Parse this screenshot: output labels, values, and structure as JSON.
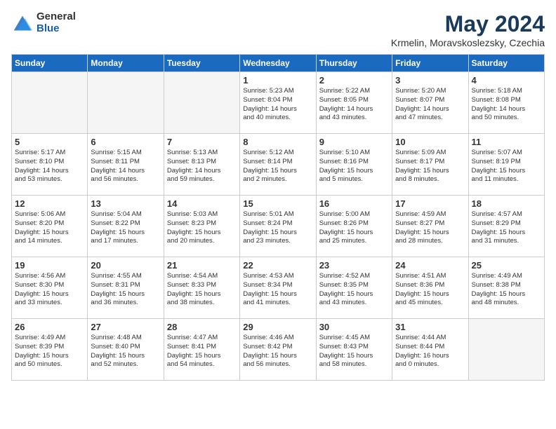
{
  "logo": {
    "general": "General",
    "blue": "Blue"
  },
  "title": {
    "month": "May 2024",
    "location": "Krmelin, Moravskoslezsky, Czechia"
  },
  "headers": [
    "Sunday",
    "Monday",
    "Tuesday",
    "Wednesday",
    "Thursday",
    "Friday",
    "Saturday"
  ],
  "weeks": [
    [
      {
        "day": "",
        "info": ""
      },
      {
        "day": "",
        "info": ""
      },
      {
        "day": "",
        "info": ""
      },
      {
        "day": "1",
        "info": "Sunrise: 5:23 AM\nSunset: 8:04 PM\nDaylight: 14 hours\nand 40 minutes."
      },
      {
        "day": "2",
        "info": "Sunrise: 5:22 AM\nSunset: 8:05 PM\nDaylight: 14 hours\nand 43 minutes."
      },
      {
        "day": "3",
        "info": "Sunrise: 5:20 AM\nSunset: 8:07 PM\nDaylight: 14 hours\nand 47 minutes."
      },
      {
        "day": "4",
        "info": "Sunrise: 5:18 AM\nSunset: 8:08 PM\nDaylight: 14 hours\nand 50 minutes."
      }
    ],
    [
      {
        "day": "5",
        "info": "Sunrise: 5:17 AM\nSunset: 8:10 PM\nDaylight: 14 hours\nand 53 minutes."
      },
      {
        "day": "6",
        "info": "Sunrise: 5:15 AM\nSunset: 8:11 PM\nDaylight: 14 hours\nand 56 minutes."
      },
      {
        "day": "7",
        "info": "Sunrise: 5:13 AM\nSunset: 8:13 PM\nDaylight: 14 hours\nand 59 minutes."
      },
      {
        "day": "8",
        "info": "Sunrise: 5:12 AM\nSunset: 8:14 PM\nDaylight: 15 hours\nand 2 minutes."
      },
      {
        "day": "9",
        "info": "Sunrise: 5:10 AM\nSunset: 8:16 PM\nDaylight: 15 hours\nand 5 minutes."
      },
      {
        "day": "10",
        "info": "Sunrise: 5:09 AM\nSunset: 8:17 PM\nDaylight: 15 hours\nand 8 minutes."
      },
      {
        "day": "11",
        "info": "Sunrise: 5:07 AM\nSunset: 8:19 PM\nDaylight: 15 hours\nand 11 minutes."
      }
    ],
    [
      {
        "day": "12",
        "info": "Sunrise: 5:06 AM\nSunset: 8:20 PM\nDaylight: 15 hours\nand 14 minutes."
      },
      {
        "day": "13",
        "info": "Sunrise: 5:04 AM\nSunset: 8:22 PM\nDaylight: 15 hours\nand 17 minutes."
      },
      {
        "day": "14",
        "info": "Sunrise: 5:03 AM\nSunset: 8:23 PM\nDaylight: 15 hours\nand 20 minutes."
      },
      {
        "day": "15",
        "info": "Sunrise: 5:01 AM\nSunset: 8:24 PM\nDaylight: 15 hours\nand 23 minutes."
      },
      {
        "day": "16",
        "info": "Sunrise: 5:00 AM\nSunset: 8:26 PM\nDaylight: 15 hours\nand 25 minutes."
      },
      {
        "day": "17",
        "info": "Sunrise: 4:59 AM\nSunset: 8:27 PM\nDaylight: 15 hours\nand 28 minutes."
      },
      {
        "day": "18",
        "info": "Sunrise: 4:57 AM\nSunset: 8:29 PM\nDaylight: 15 hours\nand 31 minutes."
      }
    ],
    [
      {
        "day": "19",
        "info": "Sunrise: 4:56 AM\nSunset: 8:30 PM\nDaylight: 15 hours\nand 33 minutes."
      },
      {
        "day": "20",
        "info": "Sunrise: 4:55 AM\nSunset: 8:31 PM\nDaylight: 15 hours\nand 36 minutes."
      },
      {
        "day": "21",
        "info": "Sunrise: 4:54 AM\nSunset: 8:33 PM\nDaylight: 15 hours\nand 38 minutes."
      },
      {
        "day": "22",
        "info": "Sunrise: 4:53 AM\nSunset: 8:34 PM\nDaylight: 15 hours\nand 41 minutes."
      },
      {
        "day": "23",
        "info": "Sunrise: 4:52 AM\nSunset: 8:35 PM\nDaylight: 15 hours\nand 43 minutes."
      },
      {
        "day": "24",
        "info": "Sunrise: 4:51 AM\nSunset: 8:36 PM\nDaylight: 15 hours\nand 45 minutes."
      },
      {
        "day": "25",
        "info": "Sunrise: 4:49 AM\nSunset: 8:38 PM\nDaylight: 15 hours\nand 48 minutes."
      }
    ],
    [
      {
        "day": "26",
        "info": "Sunrise: 4:49 AM\nSunset: 8:39 PM\nDaylight: 15 hours\nand 50 minutes."
      },
      {
        "day": "27",
        "info": "Sunrise: 4:48 AM\nSunset: 8:40 PM\nDaylight: 15 hours\nand 52 minutes."
      },
      {
        "day": "28",
        "info": "Sunrise: 4:47 AM\nSunset: 8:41 PM\nDaylight: 15 hours\nand 54 minutes."
      },
      {
        "day": "29",
        "info": "Sunrise: 4:46 AM\nSunset: 8:42 PM\nDaylight: 15 hours\nand 56 minutes."
      },
      {
        "day": "30",
        "info": "Sunrise: 4:45 AM\nSunset: 8:43 PM\nDaylight: 15 hours\nand 58 minutes."
      },
      {
        "day": "31",
        "info": "Sunrise: 4:44 AM\nSunset: 8:44 PM\nDaylight: 16 hours\nand 0 minutes."
      },
      {
        "day": "",
        "info": ""
      }
    ]
  ]
}
